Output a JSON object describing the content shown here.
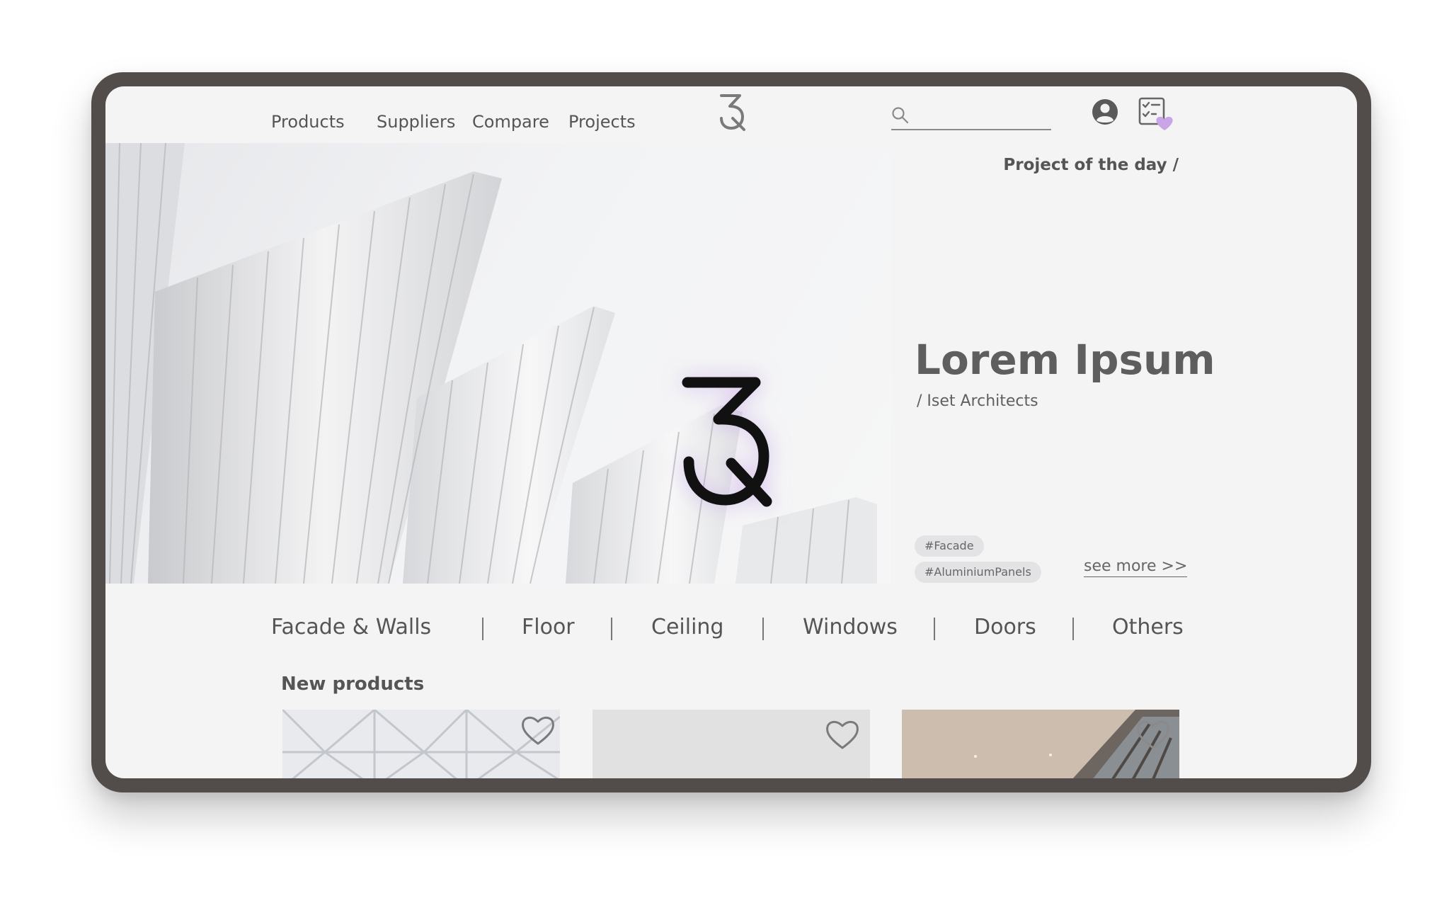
{
  "nav": {
    "links": [
      "Products",
      "Suppliers",
      "Compare",
      "Projects"
    ],
    "search_placeholder": ""
  },
  "hero": {
    "kicker": "Project of the day /",
    "title": "Lorem Ipsum",
    "subtitle": "/ Iset Architects",
    "tags": [
      "#Facade",
      "#AluminiumPanels"
    ],
    "see_more": "see more >>"
  },
  "categories": [
    "Facade & Walls",
    "Floor",
    "Ceiling",
    "Windows",
    "Doors",
    "Others"
  ],
  "new_products": {
    "title": "New products",
    "cards": [
      {
        "image": "white-triangular-tiles"
      },
      {
        "image": "grey-plaster-wall"
      },
      {
        "image": "warm-interior-window"
      }
    ]
  },
  "colors": {
    "frame": "#524d4b",
    "screen": "#f4f4f5",
    "text": "#555555",
    "accent_lavender": "#c9a4e6",
    "logo": "#111111"
  },
  "icons": {
    "search": "search-icon",
    "user": "user-icon",
    "wishlist": "checklist-heart-icon",
    "favorite": "heart-icon"
  }
}
